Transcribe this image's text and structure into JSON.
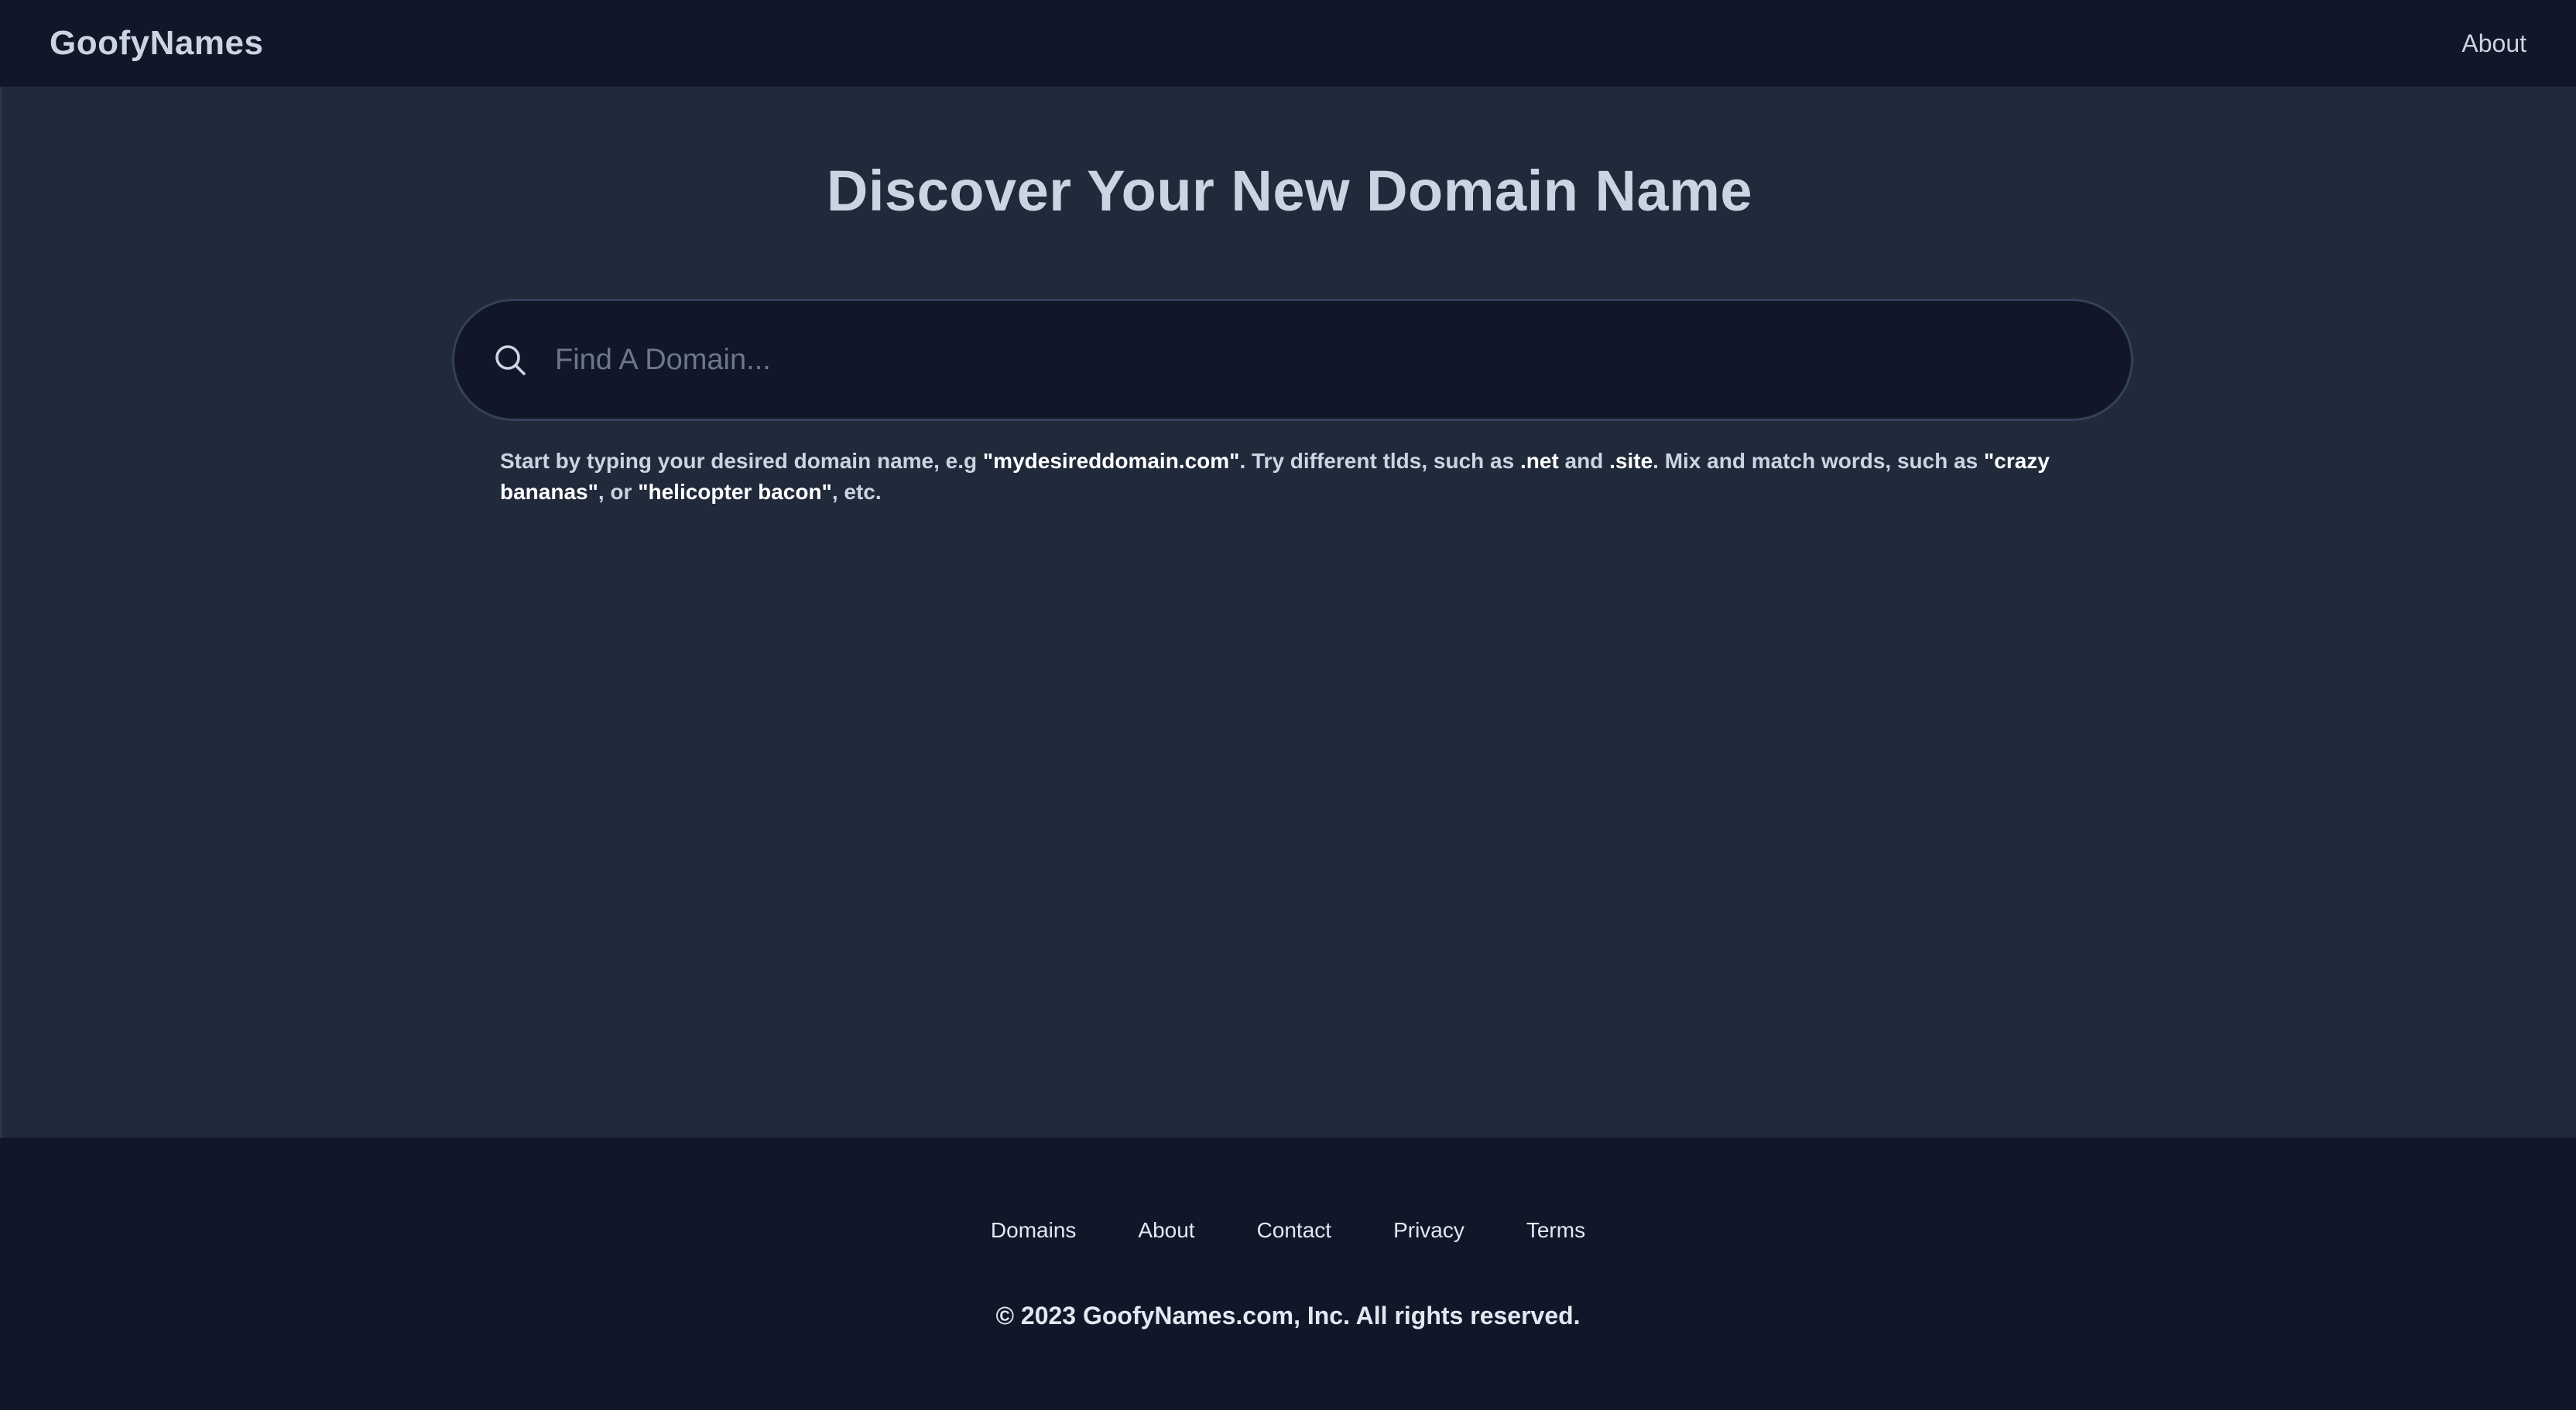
{
  "header": {
    "logo": "GoofyNames",
    "nav_about": "About"
  },
  "main": {
    "title": "Discover Your New Domain Name",
    "search": {
      "placeholder": "Find A Domain...",
      "value": "",
      "icon": "search-icon"
    },
    "hint": {
      "t1": "Start by typing your desired domain name, e.g ",
      "b1": "\"mydesireddomain.com\"",
      "t2": ". Try different tlds, such as ",
      "b2": ".net",
      "t3": " and ",
      "b3": ".site",
      "t4": ". Mix and match words, such as ",
      "b4": "\"crazy bananas\"",
      "t5": ", or ",
      "b5": "\"helicopter bacon\"",
      "t6": ", etc."
    }
  },
  "footer": {
    "links": [
      "Domains",
      "About",
      "Contact",
      "Privacy",
      "Terms"
    ],
    "copyright": "© 2023 GoofyNames.com, Inc. All rights reserved."
  },
  "colors": {
    "nav_bg": "#111729",
    "page_bg": "#202a3b",
    "text": "#cbd5e1"
  }
}
